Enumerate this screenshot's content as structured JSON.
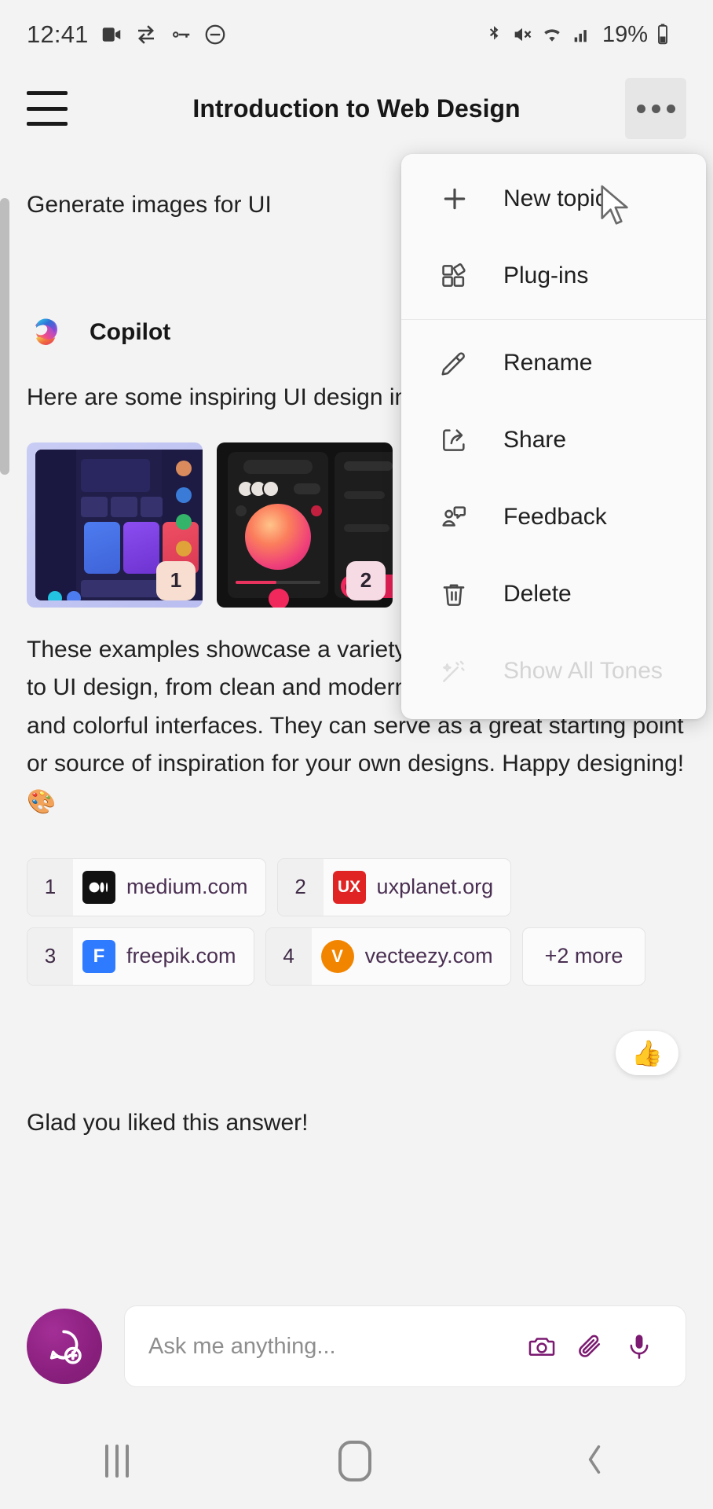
{
  "statusbar": {
    "time": "12:41",
    "battery_percent": "19%",
    "left_icons": [
      "video-camera-icon",
      "sync-icon",
      "vpn-key-icon",
      "do-not-disturb-icon"
    ],
    "right_icons": [
      "bluetooth-icon",
      "volume-muted-icon",
      "wifi-icon",
      "cellular-signal-icon",
      "battery-icon"
    ]
  },
  "appbar": {
    "menu_icon": "hamburger-icon",
    "title": "Introduction to Web Design",
    "overflow_icon": "more-options-icon"
  },
  "conversation": {
    "user_message": "Generate images for UI",
    "bot_name": "Copilot",
    "bot_logo": "copilot-logo",
    "bot_intro": "Here are some inspiring UI design images for your project:",
    "images": [
      {
        "badge": "1",
        "alt": "dark purple dashboard UI concept"
      },
      {
        "badge": "2",
        "alt": "dark music player app UI concept"
      }
    ],
    "bot_body": "These examples showcase a variety of styles and approaches to UI design, from clean and modern dashboards to creative and colorful interfaces. They can serve as a great starting point or source of inspiration for your own designs. Happy designing! 🎨",
    "trailing_emoji": "🎨",
    "reaction": "👍",
    "followup": "Glad you liked this answer!"
  },
  "citations": [
    {
      "num": "1",
      "domain": "medium.com",
      "logo_text": "M",
      "logo_color": "#111111"
    },
    {
      "num": "2",
      "domain": "uxplanet.org",
      "logo_text": "UX",
      "logo_color": "#e02424"
    },
    {
      "num": "3",
      "domain": "freepik.com",
      "logo_text": "F",
      "logo_color": "#2f7bff"
    },
    {
      "num": "4",
      "domain": "vecteezy.com",
      "logo_text": "V",
      "logo_color": "#f28500"
    }
  ],
  "citations_more": "+2 more",
  "menu": {
    "items": [
      {
        "label": "New topic",
        "icon": "plus-icon",
        "disabled": false
      },
      {
        "label": "Plug-ins",
        "icon": "plugins-icon",
        "disabled": false
      },
      {
        "label": "Rename",
        "icon": "pencil-icon",
        "disabled": false
      },
      {
        "label": "Share",
        "icon": "share-icon",
        "disabled": false
      },
      {
        "label": "Feedback",
        "icon": "feedback-icon",
        "disabled": false
      },
      {
        "label": "Delete",
        "icon": "trash-icon",
        "disabled": false
      },
      {
        "label": "Show All Tones",
        "icon": "magic-wand-icon",
        "disabled": true
      }
    ]
  },
  "composer": {
    "new_chat_icon": "new-chat-icon",
    "placeholder": "Ask me anything...",
    "camera_icon": "camera-icon",
    "attach_icon": "paperclip-icon",
    "mic_icon": "microphone-icon"
  },
  "navbar": {
    "recents": "recents-icon",
    "home": "home-icon",
    "back": "back-icon"
  },
  "colors": {
    "background": "#f3f3f3",
    "accent_purple": "#8c2080",
    "link_text": "#4a2f52"
  }
}
